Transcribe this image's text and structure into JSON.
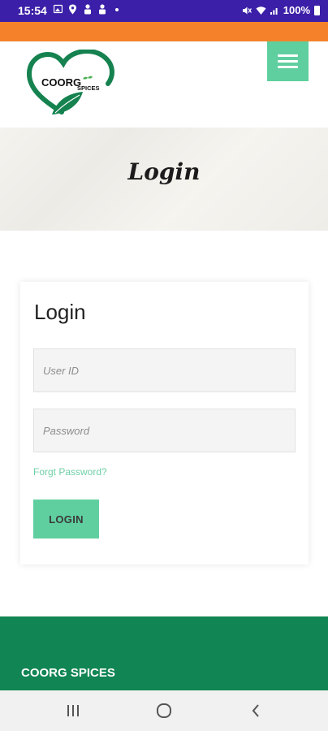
{
  "status_bar": {
    "time": "15:54",
    "battery": "100%",
    "left_icons": [
      "gallery-icon",
      "location-icon",
      "user-icon",
      "user-icon",
      "dot-icon"
    ],
    "right_icons": [
      "mute-icon",
      "wifi-icon",
      "signal-icon",
      "battery-icon"
    ]
  },
  "header": {
    "logo_text_main": "COORG",
    "logo_text_sub": "SPICES",
    "menu_icon": "hamburger-menu-icon"
  },
  "banner": {
    "title": "Login"
  },
  "login_form": {
    "heading": "Login",
    "user_id_placeholder": "User ID",
    "user_id_value": "",
    "password_placeholder": "Password",
    "password_value": "",
    "forgot_link": "Forgt Password?",
    "submit_label": "LOGIN"
  },
  "footer": {
    "title": "COORG SPICES"
  },
  "nav_bar": {
    "icons": [
      "recents-icon",
      "home-icon",
      "back-icon"
    ]
  },
  "colors": {
    "status_bar": "#3b1fa8",
    "orange_strip": "#f5822a",
    "accent_green": "#5fcf9f",
    "footer_green": "#118553",
    "logo_green": "#15824f"
  }
}
